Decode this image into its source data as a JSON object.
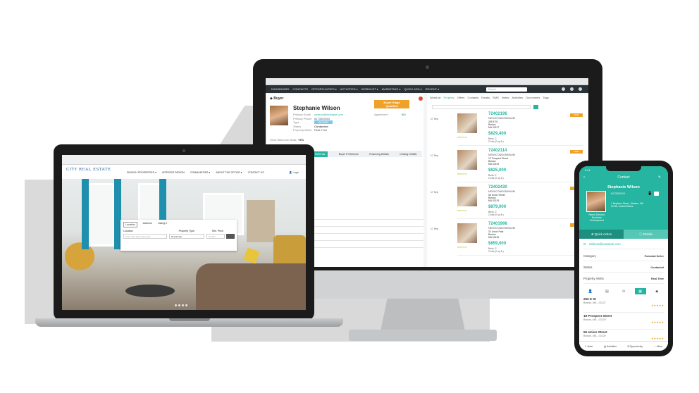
{
  "colors": {
    "accent": "#26b5a0",
    "orange": "#f0a12a",
    "dark": "#1b1b1b"
  },
  "monitor": {
    "nav_items": [
      "DASHBOARD",
      "CONTACTS",
      "OPPORTUNITIES ▾",
      "ACTIVITIES ▾",
      "WORKLIST ▾",
      "MARKETING ▾",
      "QUICK ADD ▾",
      "RECENT ▾"
    ],
    "search_placeholder": "Search",
    "section_title": "Buyer",
    "buyer_name": "Stephanie Wilson",
    "fields": [
      {
        "label": "Primary Email",
        "value": "swilson@example.com"
      },
      {
        "label": "Primary Phone",
        "value": "6173002010"
      },
      {
        "label": "Type",
        "value": "BUYER"
      },
      {
        "label": "Status",
        "value": "Contacted"
      },
      {
        "label": "Property Alerts",
        "value": "Real-Time"
      },
      {
        "label": "Send Welcome Mails",
        "value": "YES"
      }
    ],
    "qualified_label": "Buyer Stage\nQualified",
    "agreement_label": "Agreement",
    "agreement_value": "NO",
    "tabs": [
      "Referrals",
      "Buyer Preference",
      "Financing Details",
      "Closing Details"
    ],
    "right_tabs": [
      "WorkList",
      "Property",
      "Offers",
      "Contacts",
      "Emails",
      "SMS",
      "Notes",
      "Activities",
      "Documents",
      "Tags"
    ],
    "properties": [
      {
        "date": "17 Sep",
        "mls": "72402196",
        "type": "NEW/CONDOMINIUM",
        "addr": "265 E St\nBoston\nMA 02127",
        "price": "$829,400",
        "specs": "Beds: 2\n2 bds (0 sq.ft.)",
        "tag": "NEW"
      },
      {
        "date": "17 Sep",
        "mls": "72402114",
        "type": "NEW/CONDOMINIUM",
        "addr": "19 Prospect Street\nBoston\nMA 02129",
        "price": "$825,000",
        "specs": "Beds: 2\n2 bds (0 sq.ft.)",
        "tag": "NEW"
      },
      {
        "date": "17 Sep",
        "mls": "72402430",
        "type": "NEW/CONDOMINIUM",
        "addr": "56 Union Street\nBoston\nMA 02129",
        "price": "$879,000",
        "specs": "Beds: 2\n2 bds (0 sq.ft.)",
        "tag": "NEW"
      },
      {
        "date": "17 Sep",
        "mls": "72401998",
        "type": "NEW/CONDOMINIUM",
        "addr": "32 Union Park\nBoston\nMA 02118",
        "price": "$859,000",
        "specs": "Beds: 2\n2 bds (0 sq.ft.)",
        "tag": "NEW"
      }
    ]
  },
  "laptop": {
    "logo": "CITY REAL ESTATE",
    "menu": [
      "SEARCH PROPERTIES ▾",
      "INTERIOR DESIGN",
      "COMMUNITIES ▾",
      "ABOUT THE OFFICE ▾",
      "CONTACT US"
    ],
    "login": "Login",
    "search_tabs": [
      "Location",
      "Address",
      "Listing #"
    ],
    "search_labels": [
      "Location",
      "Property Type",
      "Min. Price"
    ],
    "location_placeholder": "Enter City, Town, Zip Code",
    "property_type": "Residential",
    "min_price": "No Min"
  },
  "phone": {
    "time": "9:41",
    "title": "Contact",
    "name": "Stephanie Wilson",
    "phone": "6173002010",
    "address": "1 Boylston Street , Boston, MA\n02116, United States",
    "role": "Senior Director,\nBusiness\nDevelopment",
    "quick_action": "Quick Action",
    "details": "Details",
    "email": "swilson@example.com",
    "rows": [
      {
        "label": "Category",
        "value": "Potential Seller"
      },
      {
        "label": "Status",
        "value": "Contacted"
      },
      {
        "label": "Property Alerts",
        "value": "Real-Time"
      }
    ],
    "props": [
      {
        "name": "265 E St",
        "city": "Boston, MA - 02127",
        "stars": "★★★★★"
      },
      {
        "name": "19 Prospect Street",
        "city": "Boston, MA - 02129",
        "stars": "★★★★★"
      },
      {
        "name": "56 Union Street",
        "city": "Boston, MA - 02129",
        "stars": "★★★★★"
      }
    ],
    "bottom": [
      "Note",
      "Activities",
      "Opportunity",
      "More"
    ]
  }
}
